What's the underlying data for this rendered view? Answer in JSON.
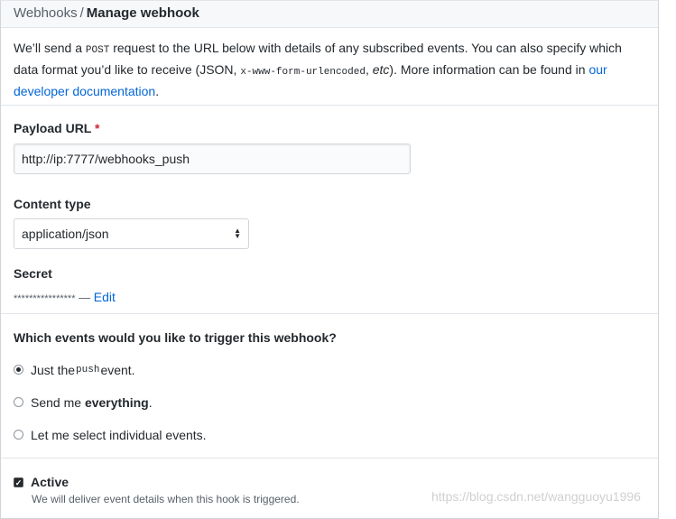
{
  "breadcrumb": {
    "parent": "Webhooks",
    "separator": "/",
    "current": "Manage webhook"
  },
  "intro": {
    "t1": "We’ll send a ",
    "code1": "POST",
    "t2": " request to the URL below with details of any subscribed events. You can also specify which data format you’d like to receive (JSON, ",
    "code2": "x-www-form-urlencoded",
    "t3": ", ",
    "etc": "etc",
    "t4": "). More information can be found in ",
    "link": "our developer documentation",
    "t5": "."
  },
  "payload": {
    "label": "Payload URL",
    "required": "*",
    "value": "http://ip:7777/webhooks_push"
  },
  "content_type": {
    "label": "Content type",
    "value": "application/json"
  },
  "secret": {
    "label": "Secret",
    "masked": "****************",
    "dash": " — ",
    "edit": "Edit"
  },
  "events": {
    "question": "Which events would you like to trigger this webhook?",
    "opt1_a": "Just the ",
    "opt1_code": "push",
    "opt1_b": " event.",
    "opt2_a": "Send me ",
    "opt2_b": "everything",
    "opt2_c": ".",
    "opt3": "Let me select individual events."
  },
  "active": {
    "label": "Active",
    "note": "We will deliver event details when this hook is triggered."
  },
  "watermark": "https://blog.csdn.net/wangguoyu1996"
}
